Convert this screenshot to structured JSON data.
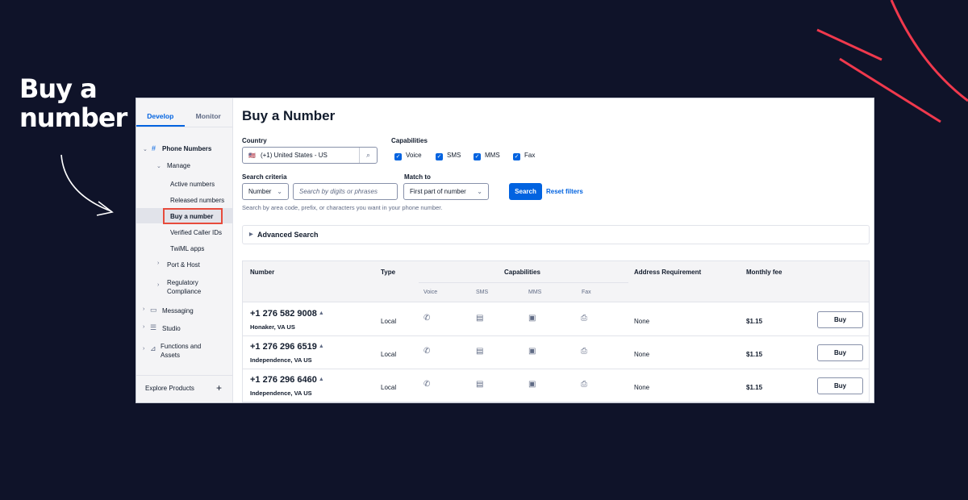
{
  "hero": {
    "line1": "Buy a",
    "line2": "number"
  },
  "colors": {
    "background": "#0f1329",
    "accent": "#0263e0",
    "highlight": "#e74b3c",
    "decoration": "#f0394d"
  },
  "sidebar": {
    "tabs": [
      "Develop",
      "Monitor"
    ],
    "active_tab": "Develop",
    "phone_numbers": "Phone Numbers",
    "manage": "Manage",
    "active_numbers": "Active numbers",
    "released_numbers": "Released numbers",
    "buy_a_number": "Buy a number",
    "verified_caller_ids": "Verified Caller IDs",
    "twiml_apps": "TwiML apps",
    "port_host": "Port & Host",
    "regulatory_1": "Regulatory",
    "regulatory_2": "Compliance",
    "messaging": "Messaging",
    "studio": "Studio",
    "functions_1": "Functions and",
    "functions_2": "Assets",
    "explore": "Explore Products",
    "explore_plus": "+"
  },
  "main": {
    "title": "Buy a Number",
    "country_label": "Country",
    "country_flag": "🇺🇸",
    "country_value": "(+1) United States - US",
    "capabilities_label": "Capabilities",
    "capabilities": [
      "Voice",
      "SMS",
      "MMS",
      "Fax"
    ],
    "criteria_label": "Search criteria",
    "criteria_value": "Number",
    "search_placeholder": "Search by digits or phrases",
    "match_label": "Match to",
    "match_value": "First part of number",
    "search_button": "Search",
    "reset_link": "Reset filters",
    "helper": "Search by area code, prefix, or characters you want in your phone number.",
    "advanced": "Advanced Search"
  },
  "table": {
    "headers": {
      "number": "Number",
      "type": "Type",
      "capabilities": "Capabilities",
      "address": "Address Requirement",
      "fee": "Monthly fee"
    },
    "sub_headers": [
      "Voice",
      "SMS",
      "MMS",
      "Fax"
    ],
    "buy_label": "Buy",
    "rows": [
      {
        "number": "+1 276 582 9008",
        "location": "Honaker, VA US",
        "type": "Local",
        "address": "None",
        "fee": "$1.15"
      },
      {
        "number": "+1 276 296 6519",
        "location": "Independence, VA US",
        "type": "Local",
        "address": "None",
        "fee": "$1.15"
      },
      {
        "number": "+1 276 296 6460",
        "location": "Independence, VA US",
        "type": "Local",
        "address": "None",
        "fee": "$1.15"
      }
    ]
  }
}
